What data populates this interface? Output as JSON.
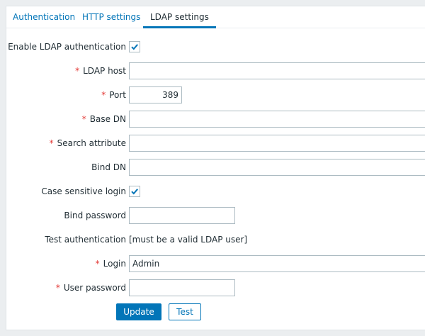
{
  "tabs": [
    "Authentication",
    "HTTP settings",
    "LDAP settings"
  ],
  "form": {
    "enable_ldap": {
      "label": "Enable LDAP authentication",
      "checked": true
    },
    "ldap_host": {
      "label": "LDAP host",
      "value": ""
    },
    "port": {
      "label": "Port",
      "value": "389"
    },
    "base_dn": {
      "label": "Base DN",
      "value": ""
    },
    "search_attribute": {
      "label": "Search attribute",
      "value": ""
    },
    "bind_dn": {
      "label": "Bind DN",
      "value": ""
    },
    "case_sensitive": {
      "label": "Case sensitive login",
      "checked": true
    },
    "bind_password": {
      "label": "Bind password",
      "value": ""
    },
    "test_auth": {
      "label": "Test authentication",
      "text": "[must be a valid LDAP user]"
    },
    "login": {
      "label": "Login",
      "value": "Admin"
    },
    "user_password": {
      "label": "User password",
      "value": ""
    },
    "required_mark": "*"
  },
  "buttons": {
    "update": "Update",
    "test": "Test"
  },
  "icons": {
    "check": "checkmark-icon"
  },
  "colors": {
    "accent": "#0275b8",
    "required": "#e33734",
    "background": "#ebeef0"
  }
}
